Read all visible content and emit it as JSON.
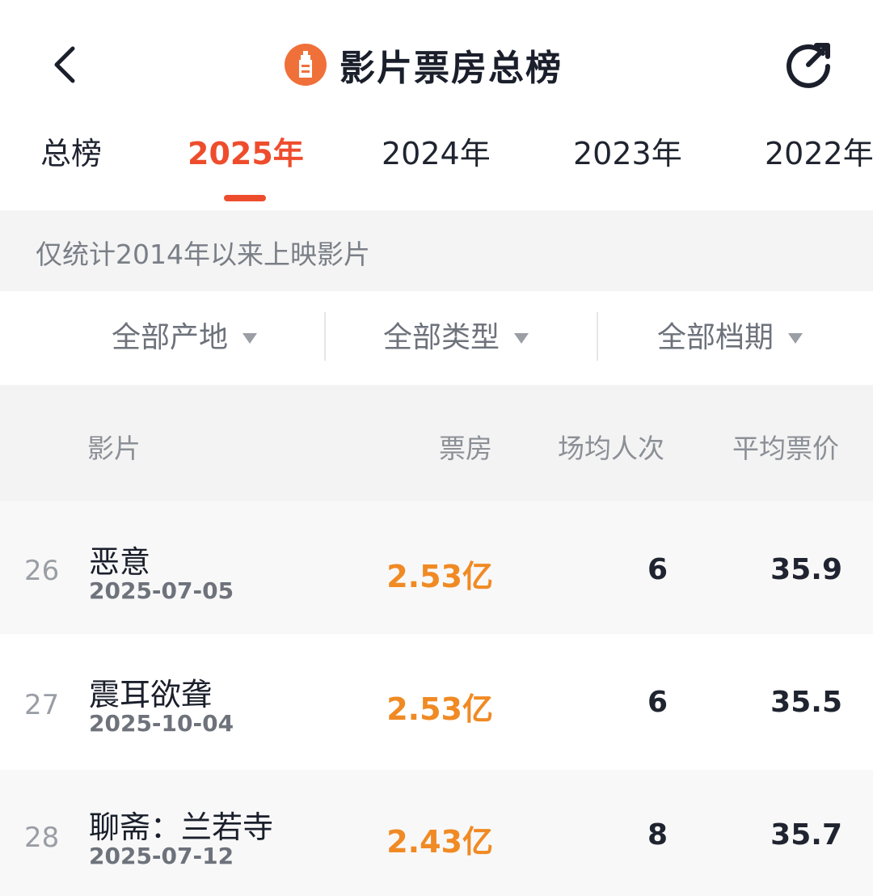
{
  "header": {
    "title": "影片票房总榜",
    "back_icon": "chevron-left-icon",
    "logo_icon": "lighthouse-logo-icon",
    "refresh_icon": "refresh-icon"
  },
  "tabs": [
    {
      "label": "总榜",
      "active": false
    },
    {
      "label": "2025年",
      "active": true
    },
    {
      "label": "2024年",
      "active": false
    },
    {
      "label": "2023年",
      "active": false
    },
    {
      "label": "2022年",
      "active": false
    }
  ],
  "notice": "仅统计2014年以来上映影片",
  "filters": [
    {
      "label": "全部产地"
    },
    {
      "label": "全部类型"
    },
    {
      "label": "全部档期"
    }
  ],
  "table": {
    "headers": {
      "movie": "影片",
      "boxoffice": "票房",
      "avg_people": "场均人次",
      "avg_price": "平均票价"
    },
    "rows": [
      {
        "rank": "26",
        "name": "恶意",
        "date": "2025-07-05",
        "boxoffice": "2.53亿",
        "avg_people": "6",
        "avg_price": "35.9"
      },
      {
        "rank": "27",
        "name": "震耳欲聋",
        "date": "2025-10-04",
        "boxoffice": "2.53亿",
        "avg_people": "6",
        "avg_price": "35.5"
      },
      {
        "rank": "28",
        "name": "聊斋：兰若寺",
        "date": "2025-07-12",
        "boxoffice": "2.43亿",
        "avg_people": "8",
        "avg_price": "35.7"
      }
    ]
  },
  "colors": {
    "accent": "#ee4d2d",
    "boxoffice": "#f08a24",
    "muted": "#8b8f96"
  }
}
